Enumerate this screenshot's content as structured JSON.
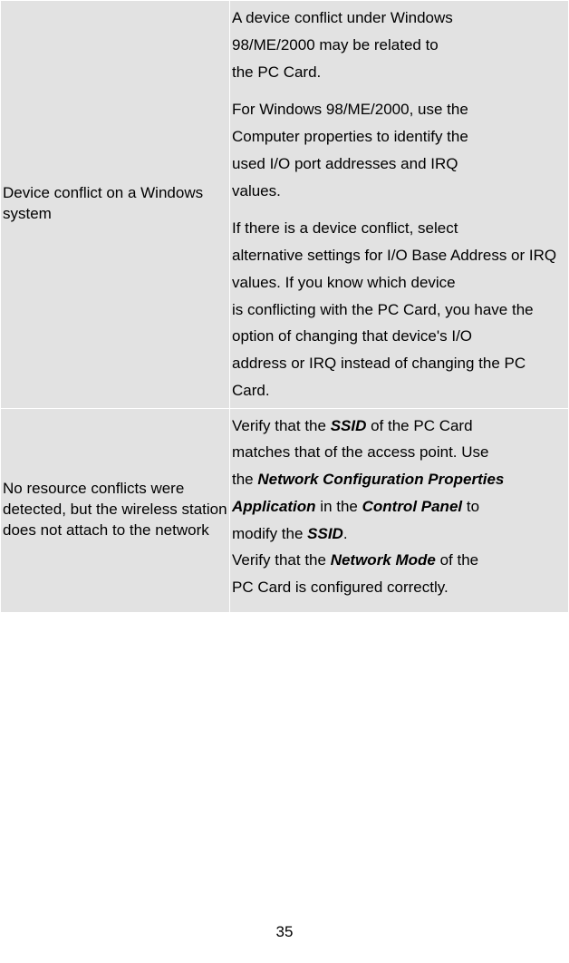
{
  "rows": [
    {
      "label": "Device conflict on a Windows system",
      "content": {
        "l1": "A device conflict under Windows",
        "l2": "98/ME/2000 may be related to",
        "l3": "the PC Card.",
        "l4": "For Windows 98/ME/2000, use the",
        "l5": "Computer properties to identify the",
        "l6": "used I/O port addresses and IRQ",
        "l7": "values.",
        "l8": "If there is a device conflict, select",
        "l9": "alternative settings for I/O Base Address or IRQ values. If you know which device",
        "l10": "is conflicting with the PC Card, you have the option of changing that device's I/O",
        "l11": "address or IRQ instead of changing the PC Card."
      }
    },
    {
      "label": "No resource conflicts were detected, but the wireless station does not attach to the network",
      "content": {
        "p1a": "Verify that the ",
        "p1b": "SSID",
        "p1c": " of the PC Card",
        "p2": "matches that of the access point. Use",
        "p3a": "the ",
        "p3b": "Network Configuration Properties",
        "p4a": "Application",
        "p4b": " in the ",
        "p4c": "Control Panel",
        "p4d": " to",
        "p5a": "modify the ",
        "p5b": "SSID",
        "p5c": ".",
        "p6a": "Verify that the ",
        "p6b": "Network Mode",
        "p6c": " of the",
        "p7": "PC Card is configured correctly."
      }
    }
  ],
  "page_number": "35"
}
